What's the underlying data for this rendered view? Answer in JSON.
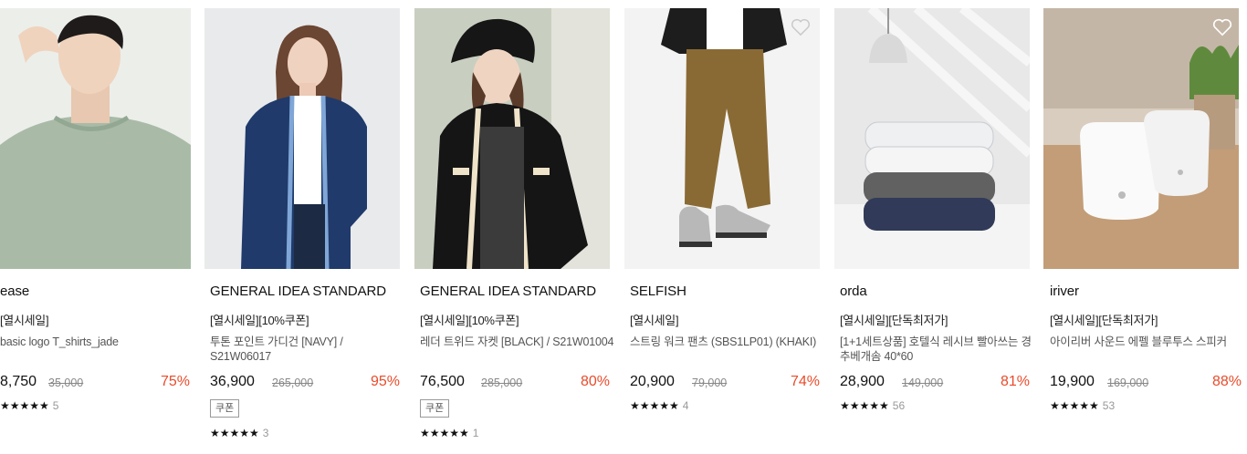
{
  "products": [
    {
      "brand": "ease",
      "tag": "[열시세일]",
      "name": "basic logo T_shirts_jade",
      "price": "8,750",
      "original": "35,000",
      "discount": "75%",
      "coupon": "",
      "stars": "★★★★★",
      "reviews": "5"
    },
    {
      "brand": "GENERAL IDEA STANDARD",
      "tag": "[열시세일][10%쿠폰]",
      "name": "투톤 포인트 가디건 [NAVY] / S21W06017",
      "price": "36,900",
      "original": "265,000",
      "discount": "95%",
      "coupon": "쿠폰",
      "stars": "★★★★★",
      "reviews": "3"
    },
    {
      "brand": "GENERAL IDEA STANDARD",
      "tag": "[열시세일][10%쿠폰]",
      "name": "레더 트위드 자켓 [BLACK] / S21W01004",
      "price": "76,500",
      "original": "285,000",
      "discount": "80%",
      "coupon": "쿠폰",
      "stars": "★★★★★",
      "reviews": "1"
    },
    {
      "brand": "SELFISH",
      "tag": "[열시세일]",
      "name": "스트링 워크 팬츠 (SBS1LP01) (KHAKI)",
      "price": "20,900",
      "original": "79,000",
      "discount": "74%",
      "coupon": "",
      "stars": "★★★★★",
      "reviews": "4"
    },
    {
      "brand": "orda",
      "tag": "[열시세일][단독최저가]",
      "name": "[1+1세트상품] 호텔식 레시브 빨아쓰는 경추베개솜 40*60",
      "price": "28,900",
      "original": "149,000",
      "discount": "81%",
      "coupon": "",
      "stars": "★★★★★",
      "reviews": "56"
    },
    {
      "brand": "iriver",
      "tag": "[열시세일][단독최저가]",
      "name": "아이리버 사운드 에펠 블루투스 스피커",
      "price": "19,900",
      "original": "169,000",
      "discount": "88%",
      "coupon": "",
      "stars": "★★★★★",
      "reviews": "53"
    }
  ],
  "icons": {
    "wishlist": "heart-outline-icon",
    "rating": "star-icon"
  },
  "colors": {
    "discount": "#e94b2b",
    "text": "#111111",
    "muted": "#888888"
  }
}
